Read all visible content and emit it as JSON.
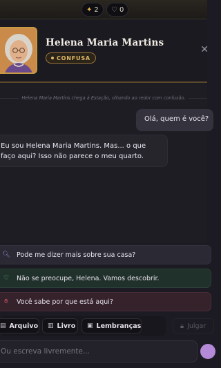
{
  "topbar": {
    "stars": "2",
    "hearts": "0"
  },
  "character": {
    "name": "Helena Maria Martins",
    "mood": "CONFUSA"
  },
  "chat": {
    "system_message": "Helena Maria Martins chega à Estação, olhando ao redor com confusão.",
    "user_message": "Olá, quem é você?",
    "npc_message": "Eu sou Helena Maria Martins. Mas... o que faço aqui? Isso não parece o meu quarto."
  },
  "suggestions": [
    {
      "label": "Pode me dizer mais sobre sua casa?",
      "icon": "search-icon",
      "color": "#9a8ad0"
    },
    {
      "label": "Não se preocupe, Helena. Vamos descobrir.",
      "icon": "heart-icon",
      "color": "#6ad08c"
    },
    {
      "label": "Você sabe por que está aqui?",
      "icon": "hand-icon",
      "color": "#e06070"
    }
  ],
  "toolbar": {
    "archive_label": "Arquivo",
    "book_label": "Livro",
    "memories_label": "Lembranças",
    "judge_label": "Julgar"
  },
  "input": {
    "placeholder": "Ou escreva livremente..."
  },
  "colors": {
    "accent_gold": "#c89a44",
    "send_button": "#b48ad8",
    "background": "#1c1a22"
  }
}
